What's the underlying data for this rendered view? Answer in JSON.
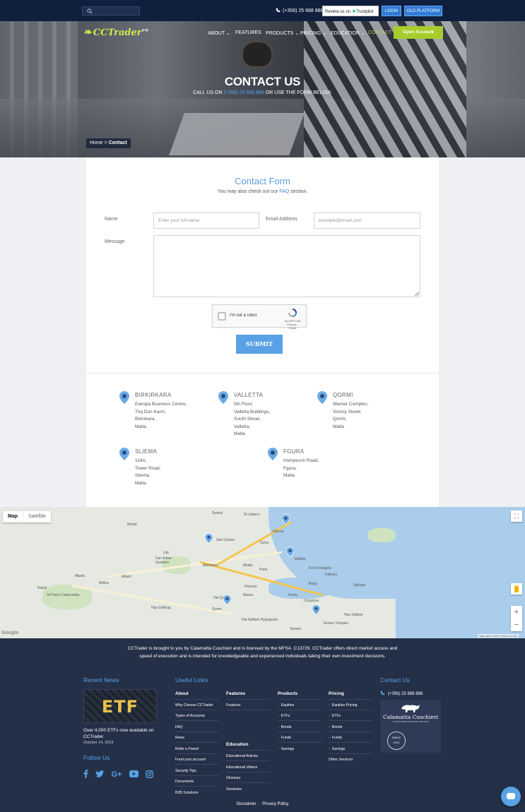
{
  "topbar": {
    "phone": "(+356) 25 688 888",
    "trustpilot": "Review us on",
    "trustpilot_brand": "Trustpilot",
    "login": "LOGIN",
    "old_platform": "OLD PLATFORM"
  },
  "header": {
    "logo": "CCTrader",
    "logo_tm": "TM",
    "nav": [
      "ABOUT",
      "FEATURES",
      "PRODUCTS",
      "PRICING",
      "EDUCATION",
      "CONTACT"
    ],
    "open_account": "Open Account"
  },
  "hero": {
    "title": "CONTACT US",
    "sub_pre": "CALL US ON ",
    "sub_num": "(+356) 25 688 888",
    "sub_post": " OR USE THE FORM BELOW.",
    "breadcrumb_home": "Home",
    "breadcrumb_sep": ">",
    "breadcrumb_current": "Contact"
  },
  "form": {
    "title": "Contact Form",
    "sub_pre": "You may also check out our ",
    "sub_link": "FAQ",
    "sub_post": " section.",
    "name_label": "Name",
    "name_placeholder": "Enter your full name",
    "email_label": "Email Address",
    "email_placeholder": "example@email.com",
    "message_label": "Message",
    "recaptcha_text": "I'm not a robot",
    "recaptcha_brand": "reCAPTCHA",
    "recaptcha_links": "Privacy - Terms",
    "submit": "SUBMIT"
  },
  "offices": [
    {
      "name": "BIRKIRKARA",
      "lines": [
        "Ewropa Business Centre,",
        "Triq Dun Karm,",
        "Birkirkara,",
        "Malta"
      ]
    },
    {
      "name": "VALLETTA",
      "lines": [
        "5th Floor,",
        "Valletta Buildings,",
        "South Street,",
        "Valletta,",
        "Malta"
      ]
    },
    {
      "name": "QORMI",
      "lines": [
        "Warner Complex,",
        "Victory Street,",
        "Qormi,",
        "Malta"
      ]
    },
    {
      "name": "SLIEMA",
      "lines": [
        "116A,",
        "Tower Road,",
        "Sliema,",
        "Malta"
      ]
    },
    {
      "name": "FGURA",
      "lines": [
        "Hompesch Road,",
        "Fgura,",
        "Malta"
      ]
    }
  ],
  "map": {
    "tab_map": "Map",
    "tab_satellite": "Satellite",
    "labels": [
      "Swieqi",
      "St Julian's",
      "Sliema",
      "Mosta",
      "San Gwann",
      "Lija",
      "San Anton Gardens",
      "Gzira",
      "Birkirkara",
      "Msida",
      "Pieta",
      "Valletta",
      "Fort St Angelo",
      "Mtarfa",
      "Attard",
      "Mdina",
      "Rabat",
      "Hamrun",
      "Kalkara",
      "Xghajra",
      "Birgu",
      "St Paul's Catacombs",
      "Marsa",
      "Paola",
      "Cospicua",
      "Hal Saflieni Hypogeum",
      "Tarxien Temples",
      "Haz-Zebbug",
      "Qormi",
      "Hal Qormi",
      "Haz-Zabbar",
      "Tarxien"
    ],
    "google": "Google",
    "mapdata": "Map data ©2019   Terms of Use"
  },
  "footer": {
    "intro": "CCTrader is brought to you by Calamatta Cuschieri and is licensed by the MFSA. C13729. CCTrader offers direct market access and speed of execution and is intended for knowledgeable and experienced individuals taking their own investment decisions.",
    "recent_news": "Recent News",
    "news_img": "ETF",
    "news_title": "Over 4,000 ETFs now available on CCTrader",
    "news_date": "October 14, 2019",
    "follow_us": "Follow Us",
    "useful_links": "Useful Links",
    "about_h": "About",
    "about_links": [
      "Why Choose CCTrader",
      "Types of Accounts",
      "FAQ",
      "News",
      "Refer a Friend",
      "Fund your account",
      "Security Tips",
      "Documents",
      "B2B Solutions"
    ],
    "features_h": "Features",
    "features_links": [
      "Features"
    ],
    "education_h": "Education",
    "education_links": [
      "Educational Articles",
      "Educational Videos",
      "Glossary",
      "Seminars"
    ],
    "products_h": "Products",
    "products_links": [
      "Equities",
      "ETFs",
      "Bonds",
      "Funds",
      "Savings"
    ],
    "pricing_h": "Pricing",
    "pricing_links": [
      "Equities Pricing",
      "ETFs",
      "Bonds",
      "Funds",
      "Savings",
      "Other Services"
    ],
    "contact_h": "Contact Us",
    "contact_phone": "(+356) 25 688 888",
    "cc_name": "Calamatta Cuschieri",
    "cc_tag": "YOUR PARTNER IN FINANCIAL SERVICES",
    "cc_since": "SINCE",
    "cc_year": "1972",
    "disclaimer": "Disclaimer",
    "privacy": "Privacy Policy"
  },
  "colors": {
    "accent": "#5aa2e6",
    "topbar": "#0f1f3d",
    "footer": "#243048",
    "open_account": "#a7cd2d",
    "logo": "#d5e84a"
  }
}
